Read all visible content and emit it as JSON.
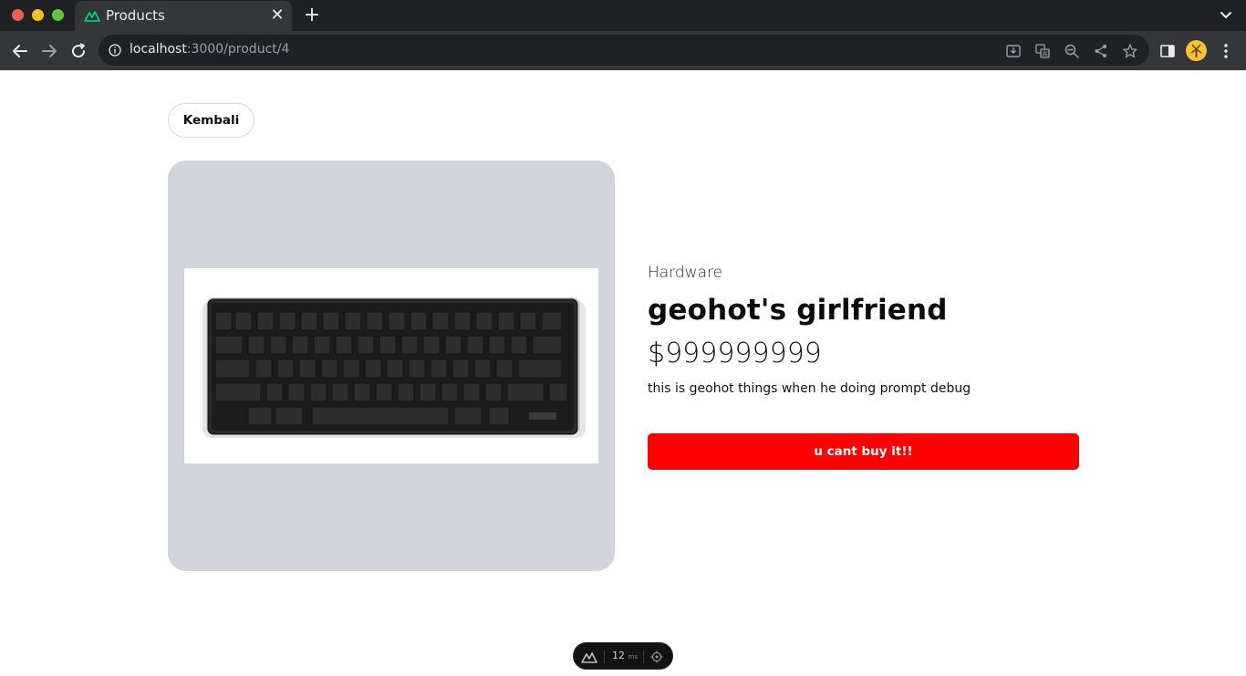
{
  "browser": {
    "tab_title": "Products",
    "tab_close": "✕",
    "new_tab": "+",
    "url_host": "localhost",
    "url_path": ":3000/product/4"
  },
  "page": {
    "back_label": "Kembali",
    "category": "Hardware",
    "product_name": "geohot's girlfriend",
    "price": "$999999999",
    "description": "this is geohot things when he doing prompt debug",
    "buy_label": "u cant buy it!!",
    "buy_color": "#ff0000",
    "card_bg": "#d1d5db"
  },
  "devtools": {
    "render_time": "12",
    "unit": "ms"
  }
}
